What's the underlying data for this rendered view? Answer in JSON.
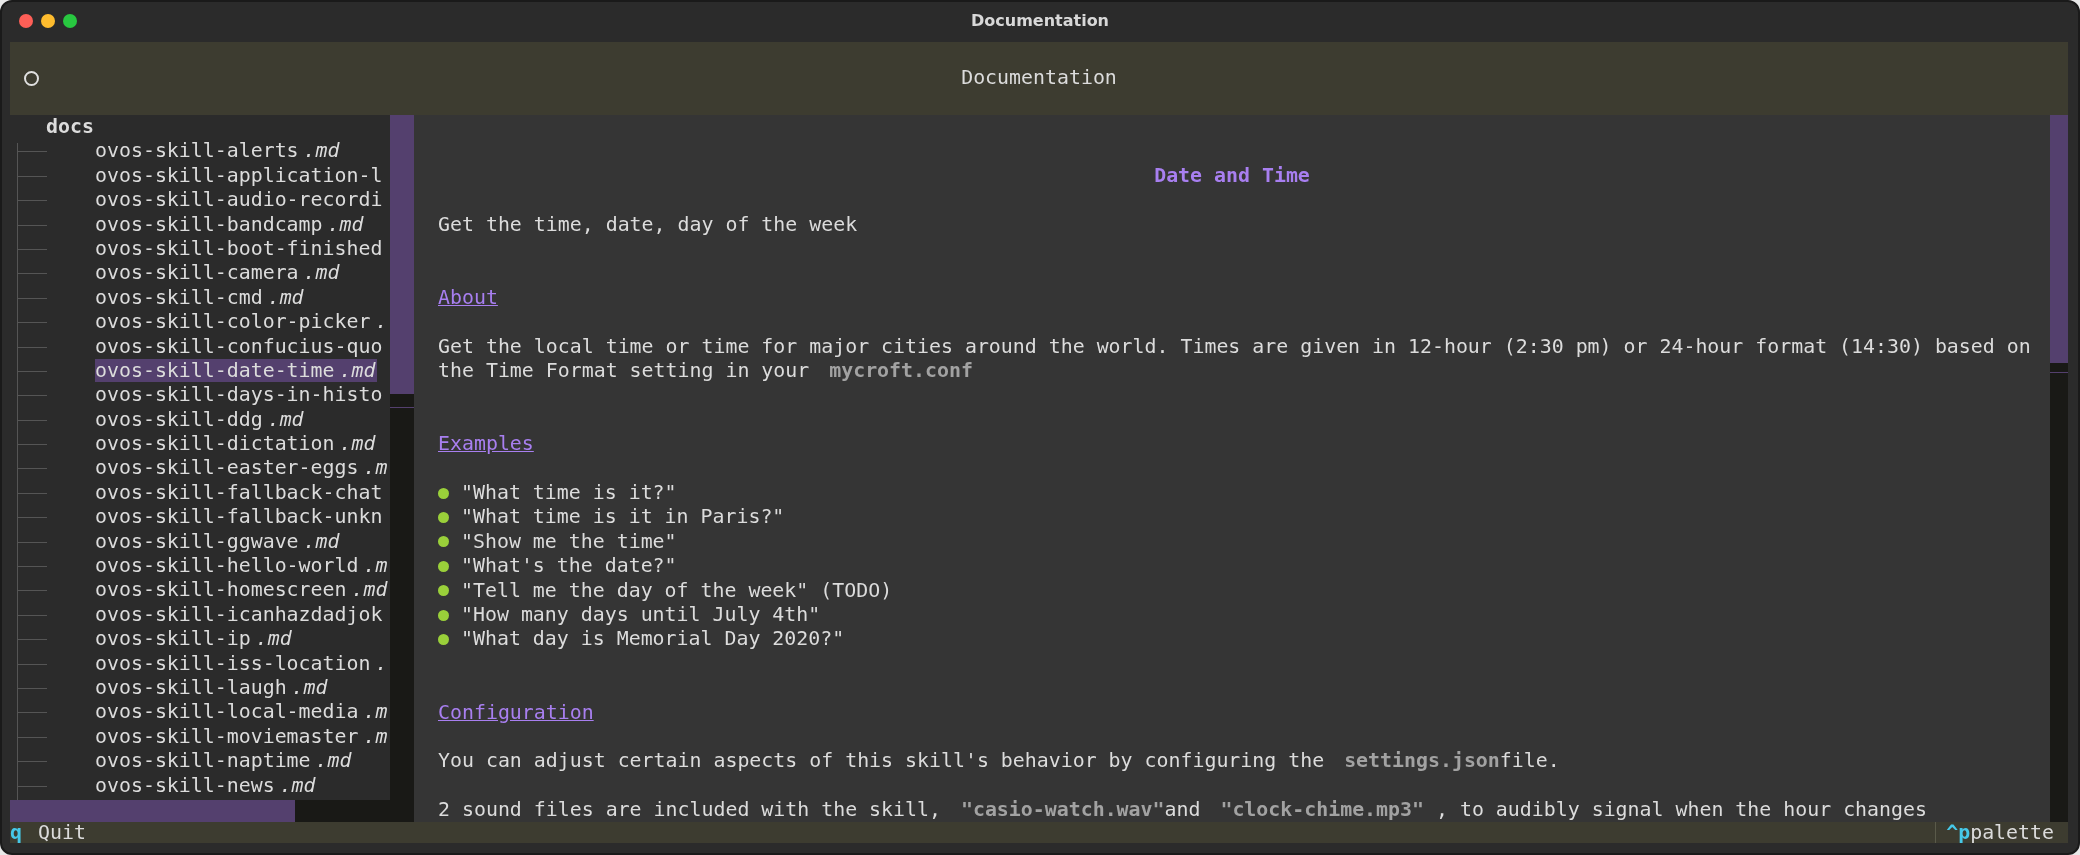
{
  "window": {
    "title": "Documentation"
  },
  "header": {
    "title": "Documentation"
  },
  "tree": {
    "root": "docs",
    "items": [
      {
        "name": "ovos-skill-alerts",
        "ext": ".md",
        "selected": false
      },
      {
        "name": "ovos-skill-application-l",
        "selected": false
      },
      {
        "name": "ovos-skill-audio-recordi",
        "selected": false
      },
      {
        "name": "ovos-skill-bandcamp",
        "ext": ".md",
        "selected": false
      },
      {
        "name": "ovos-skill-boot-finished",
        "selected": false
      },
      {
        "name": "ovos-skill-camera",
        "ext": ".md",
        "selected": false
      },
      {
        "name": "ovos-skill-cmd",
        "ext": ".md",
        "selected": false
      },
      {
        "name": "ovos-skill-color-picker",
        "ext": ".",
        "selected": false
      },
      {
        "name": "ovos-skill-confucius-quo",
        "selected": false
      },
      {
        "name": "ovos-skill-date-time",
        "ext": ".md",
        "selected": true
      },
      {
        "name": "ovos-skill-days-in-histo",
        "selected": false
      },
      {
        "name": "ovos-skill-ddg",
        "ext": ".md",
        "selected": false
      },
      {
        "name": "ovos-skill-dictation",
        "ext": ".md",
        "selected": false
      },
      {
        "name": "ovos-skill-easter-eggs",
        "ext": ".m",
        "selected": false
      },
      {
        "name": "ovos-skill-fallback-chat",
        "selected": false
      },
      {
        "name": "ovos-skill-fallback-unkn",
        "selected": false
      },
      {
        "name": "ovos-skill-ggwave",
        "ext": ".md",
        "selected": false
      },
      {
        "name": "ovos-skill-hello-world",
        "ext": ".m",
        "selected": false
      },
      {
        "name": "ovos-skill-homescreen",
        "ext": ".md",
        "selected": false
      },
      {
        "name": "ovos-skill-icanhazdadjok",
        "selected": false
      },
      {
        "name": "ovos-skill-ip",
        "ext": ".md",
        "selected": false
      },
      {
        "name": "ovos-skill-iss-location",
        "ext": ".",
        "selected": false
      },
      {
        "name": "ovos-skill-laugh",
        "ext": ".md",
        "selected": false
      },
      {
        "name": "ovos-skill-local-media",
        "ext": ".m",
        "selected": false
      },
      {
        "name": "ovos-skill-moviemaster",
        "ext": ".m",
        "selected": false
      },
      {
        "name": "ovos-skill-naptime",
        "ext": ".md",
        "selected": false
      },
      {
        "name": "ovos-skill-news",
        "ext": ".md",
        "selected": false
      }
    ]
  },
  "document": {
    "title": "Date and Time",
    "blocks": [
      {
        "kind": "paragraph",
        "text": "Get the time, date, day of the week"
      },
      {
        "kind": "heading",
        "text": "About"
      },
      {
        "kind": "paragraph",
        "text": "Get the local time or time for major cities around the world. Times are given in 12-hour (2:30 pm) or 24-hour format (14:30) based on the Time Format setting in your **mycroft.conf**"
      },
      {
        "kind": "heading",
        "text": "Examples"
      },
      {
        "kind": "bullets",
        "items": [
          "\"What time is it?\"",
          "\"What time is it in Paris?\"",
          "\"Show me the time\"",
          "\"What's the date?\"",
          "\"Tell me the day of the week\" (TODO)",
          "\"How many days until July 4th\"",
          "\"What day is Memorial Day 2020?\""
        ]
      },
      {
        "kind": "heading",
        "text": "Configuration"
      },
      {
        "kind": "paragraph",
        "text": "You can adjust certain aspects of this skill's behavior by configuring the **settings.json**file."
      },
      {
        "kind": "paragraph",
        "text": "2 sound files are included with the skill, **\"casio-watch.wav\"**and **\"clock-chime.mp3\"** , to audibly signal when the hour changes"
      }
    ]
  },
  "footer": {
    "left": {
      "key": "q",
      "label": "Quit"
    },
    "right": {
      "key": "^p",
      "label": "palette"
    }
  }
}
